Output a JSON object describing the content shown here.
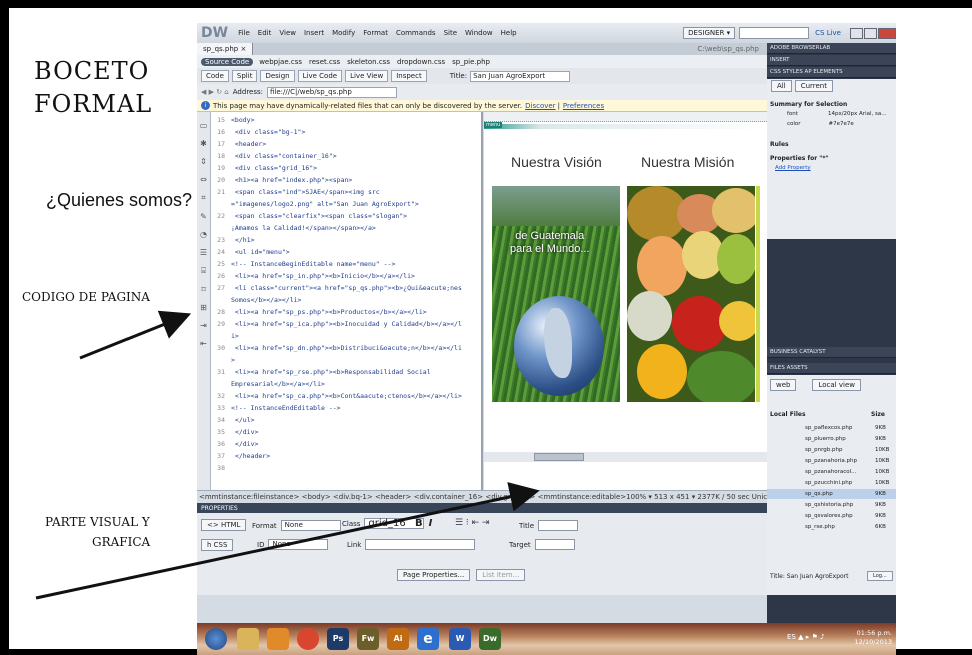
{
  "labels": {
    "title1": "BOCETO",
    "title2": "FORMAL",
    "quienes": "¿Quienes somos?",
    "codigo": "CODIGO DE PAGINA",
    "parte1": "PARTE VISUAL Y",
    "parte2": "GRAFICA"
  },
  "app": {
    "logo": "DW",
    "menu": [
      "File",
      "Edit",
      "View",
      "Insert",
      "Modify",
      "Format",
      "Commands",
      "Site",
      "Window",
      "Help"
    ],
    "workspace": "DESIGNER ▾",
    "cslive": "CS Live",
    "doc_tab": "sp_qs.php ×",
    "doc_path": "C:\\web\\sp_qs.php",
    "related": [
      "Source Code",
      "webpjae.css",
      "reset.css",
      "skeleton.css",
      "dropdown.css",
      "sp_pie.php"
    ],
    "views": [
      "Code",
      "Split",
      "Design",
      "Live Code",
      "Live View",
      "Inspect"
    ],
    "title_label": "Title:",
    "title_value": "San Juan AgroExport",
    "address_label": "Address:",
    "address_value": "file:///C|/web/sp_qs.php",
    "info": {
      "text": "This page may have dynamically-related files that can only be discovered by the server.",
      "discover": "Discover",
      "preferences": "Preferences"
    },
    "status": {
      "tags": "<mmtinstance:fileinstance> <body> <div.bq-1> <header> <div.container_16> <div.grid_16> <mmtinstance:editable>",
      "info": "100% ▾ 513 x 451 ▾ 2377K / 50 sec Unicode (UTF-8)"
    }
  },
  "code": [
    {
      "n": "15",
      "t": "<body>"
    },
    {
      "n": "16",
      "t": "  <div class=\"bg-1\">"
    },
    {
      "n": "17",
      "t": "    <header>"
    },
    {
      "n": "18",
      "t": "      <div class=\"container_16\">"
    },
    {
      "n": "19",
      "t": "        <div class=\"grid_16\">"
    },
    {
      "n": "20",
      "t": "          <h1><a href=\"index.php\"><span>"
    },
    {
      "n": "21",
      "t": "            <span class=\"ind\">SJAE</span><img src"
    },
    {
      "n": "",
      "t": "=\"imagenes/logo2.png\" alt=\"San Juan AgroExport\">"
    },
    {
      "n": "22",
      "t": "            <span class=\"clearfix\"><span class=\"slogan\">"
    },
    {
      "n": "",
      "t": "¡Amamos la Calidad!</span></span></a>"
    },
    {
      "n": "23",
      "t": "          </h1>"
    },
    {
      "n": "24",
      "t": "          <ul id=\"menu\">"
    },
    {
      "n": "25",
      "t": "<!-- InstanceBeginEditable name=\"menu\" -->"
    },
    {
      "n": "26",
      "t": "  <li><a href=\"sp_in.php\"><b>Inicio</b></a></li>"
    },
    {
      "n": "27",
      "t": "  <li class=\"current\"><a href=\"sp_qs.php\"><b>¿Qui&eacute;nes"
    },
    {
      "n": "",
      "t": "Somos</b></a></li>"
    },
    {
      "n": "28",
      "t": "  <li><a href=\"sp_ps.php\"><b>Productos</b></a></li>"
    },
    {
      "n": "29",
      "t": "  <li><a href=\"sp_ica.php\"><b>Inocuidad y Calidad</b></a></l"
    },
    {
      "n": "",
      "t": "i>"
    },
    {
      "n": "30",
      "t": "  <li><a href=\"sp_dn.php\"><b>Distribuci&oacute;n</b></a></li"
    },
    {
      "n": "",
      "t": ">"
    },
    {
      "n": "31",
      "t": "  <li><a href=\"sp_rse.php\"><b>Responsabilidad Social"
    },
    {
      "n": "",
      "t": "Empresarial</b></a></li>"
    },
    {
      "n": "32",
      "t": "  <li><a href=\"sp_ca.php\"><b>Cont&aacute;ctenos</b></a></li>"
    },
    {
      "n": "33",
      "t": "<!-- InstanceEndEditable -->"
    },
    {
      "n": "34",
      "t": "          </ul>"
    },
    {
      "n": "35",
      "t": "        </div>"
    },
    {
      "n": "36",
      "t": "      </div>"
    },
    {
      "n": "37",
      "t": "    </header>"
    },
    {
      "n": "38",
      "t": ""
    }
  ],
  "design": {
    "menu_tag": "menu",
    "vision": "Nuestra Visión",
    "mision": "Nuestra Misión",
    "overlay": [
      "de Guatemala",
      "para el Mundo..."
    ]
  },
  "props": {
    "header": "PROPERTIES",
    "html": "<> HTML",
    "css": "h CSS",
    "format_label": "Format",
    "format_value": "None",
    "id_label": "ID",
    "id_value": "None",
    "class_label": "Class",
    "class_value": "grid_16",
    "bold": "B",
    "italic": "I",
    "list_icons": "☰ ⁝ ⇤ ⇥",
    "title_label": "Title",
    "link_label": "Link",
    "target_label": "Target",
    "page_properties": "Page Properties...",
    "list_item": "List Item..."
  },
  "panel": {
    "headers": [
      "ADOBE BROWSERLAB",
      "INSERT",
      "CSS STYLES   AP ELEMENTS",
      "BUSINESS CATALYST",
      "FILES   ASSETS"
    ],
    "css": {
      "all": "All",
      "current": "Current",
      "summary": "Summary for Selection",
      "font_label": "font",
      "font_value": "14px/20px Arial, sa...",
      "color_label": "color",
      "color_value": "#7e7e7e",
      "rules": "Rules",
      "props_for": "Properties for \"*\"",
      "add_property": "Add Property"
    },
    "files": {
      "site": "web",
      "view": "Local view",
      "local_files": "Local Files",
      "size": "Size",
      "rows": [
        {
          "name": "sp_paflexcos.php",
          "size": "9KB"
        },
        {
          "name": "sp_pluerro.php",
          "size": "9KB"
        },
        {
          "name": "sp_pnrgb.php",
          "size": "10KB"
        },
        {
          "name": "sp_pzanahoria.php",
          "size": "10KB"
        },
        {
          "name": "sp_pzanahoracol...",
          "size": "10KB"
        },
        {
          "name": "sp_pzucchini.php",
          "size": "10KB"
        },
        {
          "name": "sp_qs.php",
          "size": "9KB"
        },
        {
          "name": "sp_qshistoria.php",
          "size": "9KB"
        },
        {
          "name": "sp_qsvalores.php",
          "size": "9KB"
        },
        {
          "name": "sp_rse.php",
          "size": "6KB"
        }
      ],
      "status": "Title: San Juan AgroExport",
      "log": "Log..."
    }
  },
  "taskbar": {
    "ps": "Ps",
    "fw": "Fw",
    "ai": "Ai",
    "ie": "e",
    "w": "W",
    "dw": "Dw",
    "lang": "ES ▲ ▸ ⚑ ♪",
    "time": "01:56 p.m.",
    "date": "12/10/2013"
  }
}
